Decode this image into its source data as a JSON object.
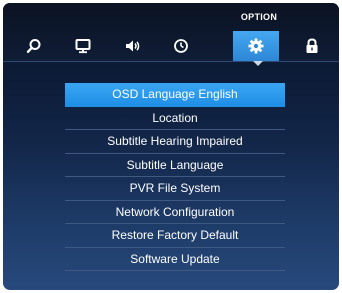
{
  "header": {
    "section_title": "OPTION"
  },
  "tabs": [
    {
      "icon": "search-icon",
      "active": false
    },
    {
      "icon": "monitor-icon",
      "active": false
    },
    {
      "icon": "speaker-icon",
      "active": false
    },
    {
      "icon": "clock-icon",
      "active": false
    },
    {
      "icon": "gear-icon",
      "active": true
    },
    {
      "icon": "lock-icon",
      "active": false
    }
  ],
  "menu": {
    "items": [
      {
        "label": "OSD Language English",
        "selected": true
      },
      {
        "label": "Location"
      },
      {
        "label": "Subtitle Hearing Impaired"
      },
      {
        "label": "Subtitle Language"
      },
      {
        "label": "PVR File System"
      },
      {
        "label": "Network Configuration"
      },
      {
        "label": "Restore Factory Default"
      },
      {
        "label": "Software Update"
      }
    ]
  },
  "colors": {
    "accent": "#2d9bea",
    "background_top": "#0a1426",
    "background_bottom": "#27497c"
  }
}
